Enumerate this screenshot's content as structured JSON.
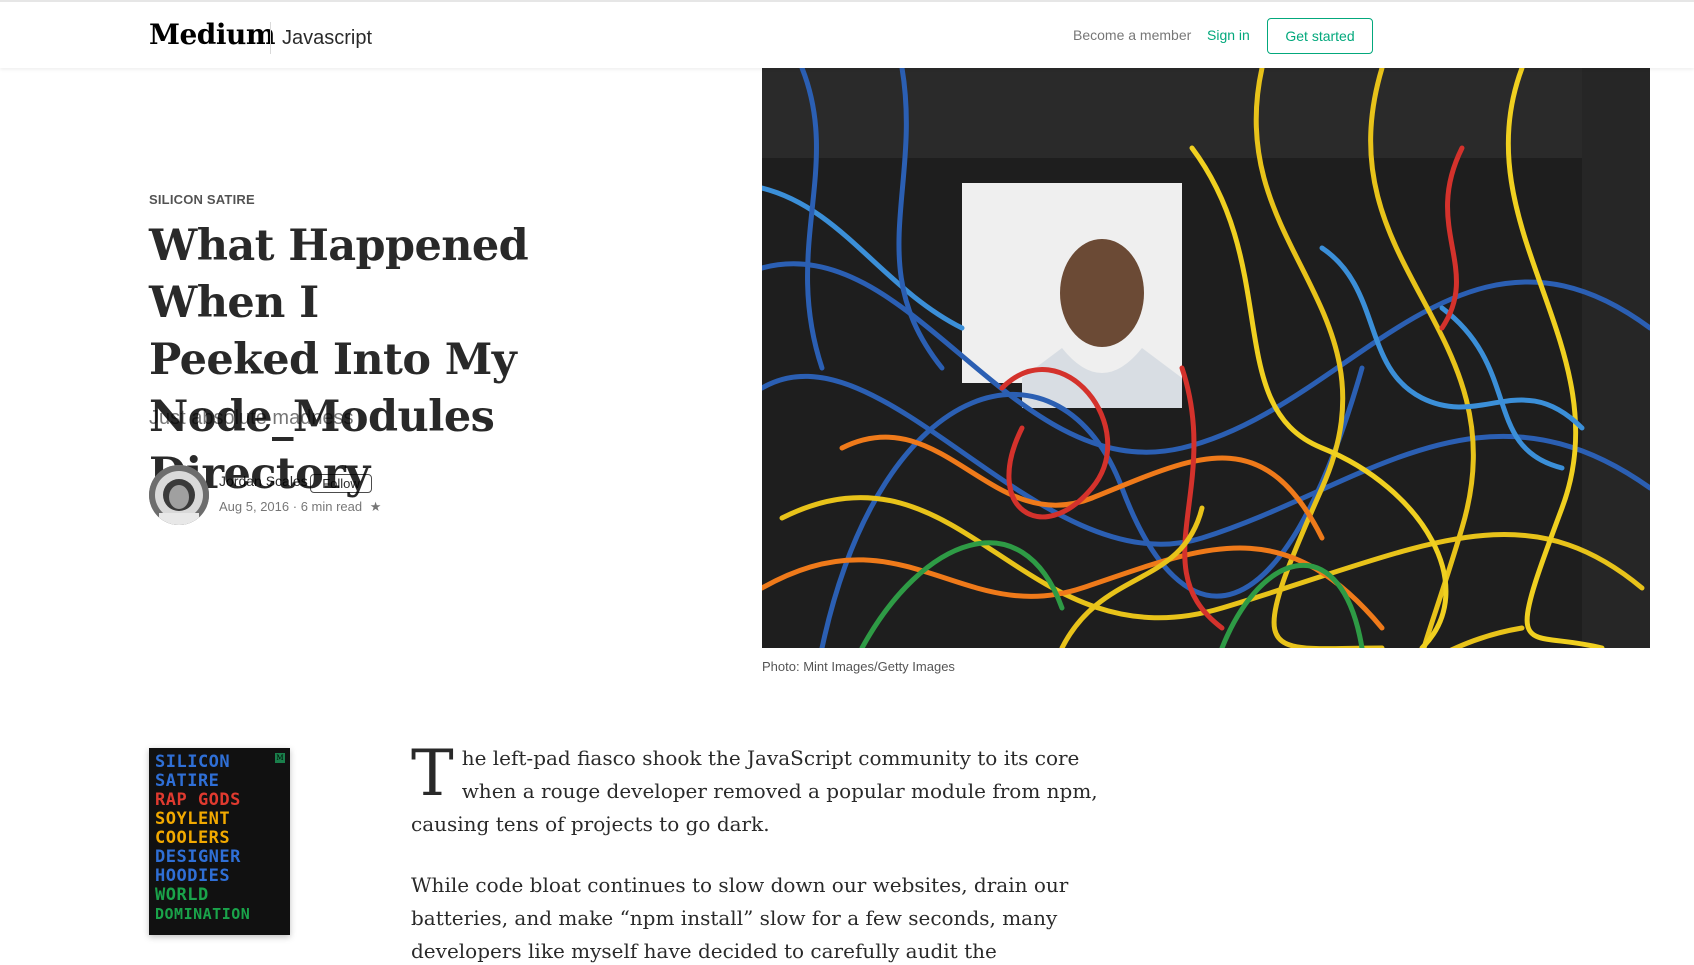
{
  "header": {
    "logo": "Medium",
    "section": "Javascript",
    "become_member": "Become a member",
    "sign_in": "Sign in",
    "get_started": "Get started"
  },
  "article": {
    "kicker": "SILICON SATIRE",
    "title_lines": [
      "What Happened When I",
      "Peeked Into My",
      "Node_Modules Directory"
    ],
    "subtitle": "Just absolute madness",
    "author": "Jordan Scales",
    "follow": "Follow",
    "date": "Aug 5, 2016",
    "read_time": "6 min read",
    "star": "★",
    "caption": "Photo: Mint Images/Getty Images"
  },
  "series_cover": {
    "lines": [
      {
        "text": "SILICON",
        "color": "#2f6fd6"
      },
      {
        "text": "SATIRE",
        "color": "#2f6fd6"
      },
      {
        "text": "RAP GODS",
        "color": "#e03a2f"
      },
      {
        "text": "SOYLENT",
        "color": "#f2a900"
      },
      {
        "text": "COOLERS",
        "color": "#f2a900"
      },
      {
        "text": "DESIGNER",
        "color": "#2f6fd6"
      },
      {
        "text": "HOODIES",
        "color": "#2f6fd6"
      },
      {
        "text": "WORLD",
        "color": "#1aa34a"
      },
      {
        "text": "DOMINATION",
        "color": "#1aa34a"
      }
    ]
  },
  "body": {
    "dropcap": "T",
    "para1": "he left-pad fiasco shook the JavaScript community to its core when a rouge developer removed a popular module from npm, causing tens of projects to go dark.",
    "para2": "While code bloat continues to slow down our websites, drain our batteries, and make “npm install” slow for a few seconds, many developers like myself have decided to carefully audit the dependencies we bring into our projects."
  }
}
